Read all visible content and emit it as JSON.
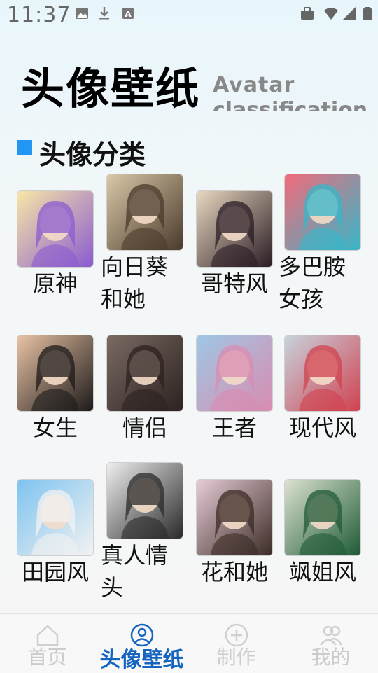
{
  "status_bar": {
    "time": "11:37"
  },
  "header": {
    "title": "头像壁纸",
    "subtitle": "Avatar",
    "subtitle2": "classification"
  },
  "section": {
    "title": "头像分类"
  },
  "categories": [
    {
      "label": "原神",
      "colors": [
        "#f7e7a6",
        "#8a5bd0"
      ]
    },
    {
      "label": "向日葵和她",
      "colors": [
        "#d9c8a8",
        "#4a3a2c"
      ]
    },
    {
      "label": "哥特风",
      "colors": [
        "#e9d8c0",
        "#2a1c24"
      ]
    },
    {
      "label": "多巴胺女孩",
      "colors": [
        "#f26a7a",
        "#36b7c9"
      ]
    },
    {
      "label": "女生",
      "colors": [
        "#e8c3a5",
        "#1d1a1a"
      ]
    },
    {
      "label": "情侣",
      "colors": [
        "#7a6a62",
        "#2c2220"
      ]
    },
    {
      "label": "王者",
      "colors": [
        "#9fc7e6",
        "#d98cb0"
      ]
    },
    {
      "label": "现代风",
      "colors": [
        "#c7d3dd",
        "#d0414f"
      ]
    },
    {
      "label": "田园风",
      "colors": [
        "#7ec3ef",
        "#f2f2f2"
      ]
    },
    {
      "label": "真人情头",
      "colors": [
        "#efefef",
        "#2a2a2a"
      ]
    },
    {
      "label": "花和她",
      "colors": [
        "#e8cdd8",
        "#3b2b25"
      ]
    },
    {
      "label": "飒姐风",
      "colors": [
        "#dbe2d0",
        "#1f5a37"
      ]
    }
  ],
  "nav": [
    {
      "label": "首页",
      "icon": "home-icon",
      "active": false
    },
    {
      "label": "头像壁纸",
      "icon": "avatar-icon",
      "active": true
    },
    {
      "label": "制作",
      "icon": "add-circle-icon",
      "active": false
    },
    {
      "label": "我的",
      "icon": "profile-icon",
      "active": false
    }
  ]
}
